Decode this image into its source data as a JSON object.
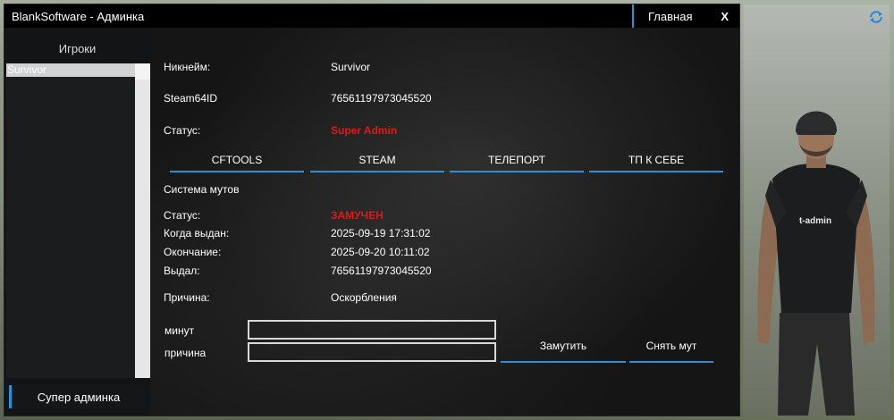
{
  "window": {
    "title": "BlankSoftware - Админка",
    "tab": "Главная",
    "close": "X"
  },
  "left": {
    "header": "Игроки",
    "players": [
      "Survivor"
    ],
    "super_button": "Супер админка"
  },
  "player": {
    "nick_label": "Никнейм:",
    "nick": "Survivor",
    "steam_label": "Steam64ID",
    "steam": "76561197973045520",
    "status_label": "Статус:",
    "status": "Super Admin"
  },
  "tabs": [
    "CFTOOLS",
    "STEAM",
    "ТЕЛЕПОРТ",
    "ТП К СЕБЕ"
  ],
  "mute": {
    "section_title": "Система мутов",
    "status_label": "Статус:",
    "status": "ЗАМУЧЕН",
    "issued_label": "Когда выдан:",
    "issued": "2025-09-19 17:31:02",
    "end_label": "Окончание:",
    "end": "2025-09-20 10:11:02",
    "by_label": "Выдал:",
    "by": "76561197973045520",
    "reason_label": "Причина:",
    "reason": "Оскорбления",
    "minutes_label": "минут",
    "minutes_value": "",
    "reason_input_label": "причина",
    "reason_input_value": "",
    "mute_button": "Замутить",
    "unmute_button": "Снять мут"
  },
  "colors": {
    "accent": "#2d8fd8",
    "status_red": "#e01818"
  },
  "icons": {
    "rotate": "rotate-icon"
  },
  "character": {
    "shirt_text": "t-admin"
  }
}
